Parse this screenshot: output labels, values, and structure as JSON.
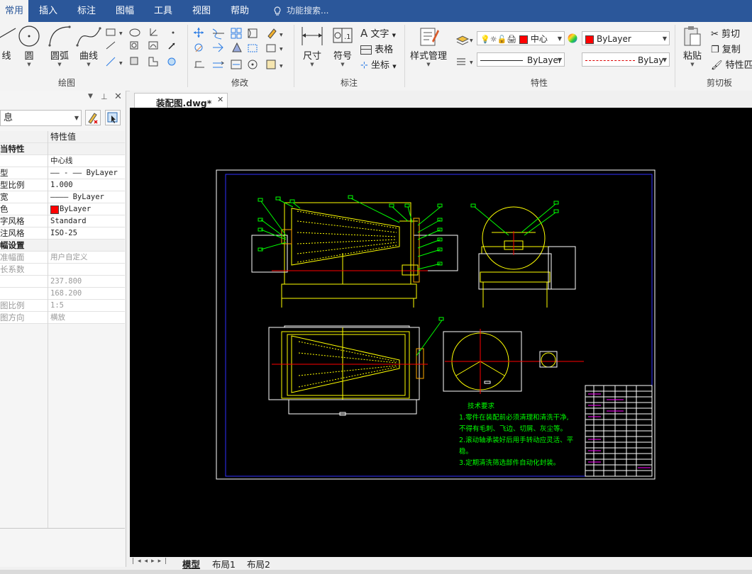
{
  "menu": {
    "tabs": [
      "常用",
      "插入",
      "标注",
      "图幅",
      "工具",
      "视图",
      "帮助"
    ],
    "search_placeholder": "功能搜索..."
  },
  "ribbon": {
    "draw": {
      "label": "绘图",
      "buttons": [
        "线",
        "圆",
        "圆弧",
        "曲线"
      ]
    },
    "modify": {
      "label": "修改"
    },
    "dimension": {
      "label": "标注",
      "buttons": [
        "尺寸",
        "符号"
      ],
      "small": [
        "文字",
        "表格",
        "坐标"
      ]
    },
    "properties": {
      "label": "特性",
      "style_manager": "样式管理",
      "layer_value": "中心",
      "color_value": "ByLayer",
      "linetype_value": "ByLayer",
      "lineweight_value": "ByLay",
      "layer_color": "#ff0000"
    },
    "clipboard": {
      "label": "剪切板",
      "paste": "粘贴",
      "cut": "剪切",
      "copy": "复制",
      "match": "特性匹"
    }
  },
  "panel": {
    "selector_value": "息",
    "header": {
      "key": "",
      "value": "特性值"
    },
    "rows": [
      {
        "k": "当特性",
        "v": "",
        "type": "section"
      },
      {
        "k": "",
        "v": "中心线"
      },
      {
        "k": "型",
        "v": "—— - —— ByLayer"
      },
      {
        "k": "型比例",
        "v": "1.000"
      },
      {
        "k": "宽",
        "v": "———— ByLayer"
      },
      {
        "k": "色",
        "v": "ByLayer"
      },
      {
        "k": "字风格",
        "v": "Standard"
      },
      {
        "k": "注风格",
        "v": "ISO-25"
      },
      {
        "k": "幅设置",
        "v": "",
        "type": "section"
      },
      {
        "k": "准幅面",
        "v": "用户自定义",
        "type": "dis"
      },
      {
        "k": "长系数",
        "v": "",
        "type": "dis"
      },
      {
        "k": "",
        "v": "237.800",
        "type": "dis"
      },
      {
        "k": "",
        "v": "168.200",
        "type": "dis"
      },
      {
        "k": "图比例",
        "v": "1:5",
        "type": "dis"
      },
      {
        "k": "图方向",
        "v": "横放",
        "type": "dis"
      }
    ]
  },
  "document": {
    "tab_title": "装配图.dwg*"
  },
  "drawing": {
    "notes": [
      "技术要求",
      "1.零件在装配前必须清理和清洗干净,",
      "不得有毛刺、飞边、切屑、灰尘等。",
      "2.滚动轴承装好后用手转动应灵活、平",
      "稳。",
      "3.定期清洗筛选部件自动化封装。"
    ]
  },
  "layouts": {
    "tabs": [
      "模型",
      "布局1",
      "布局2"
    ]
  }
}
